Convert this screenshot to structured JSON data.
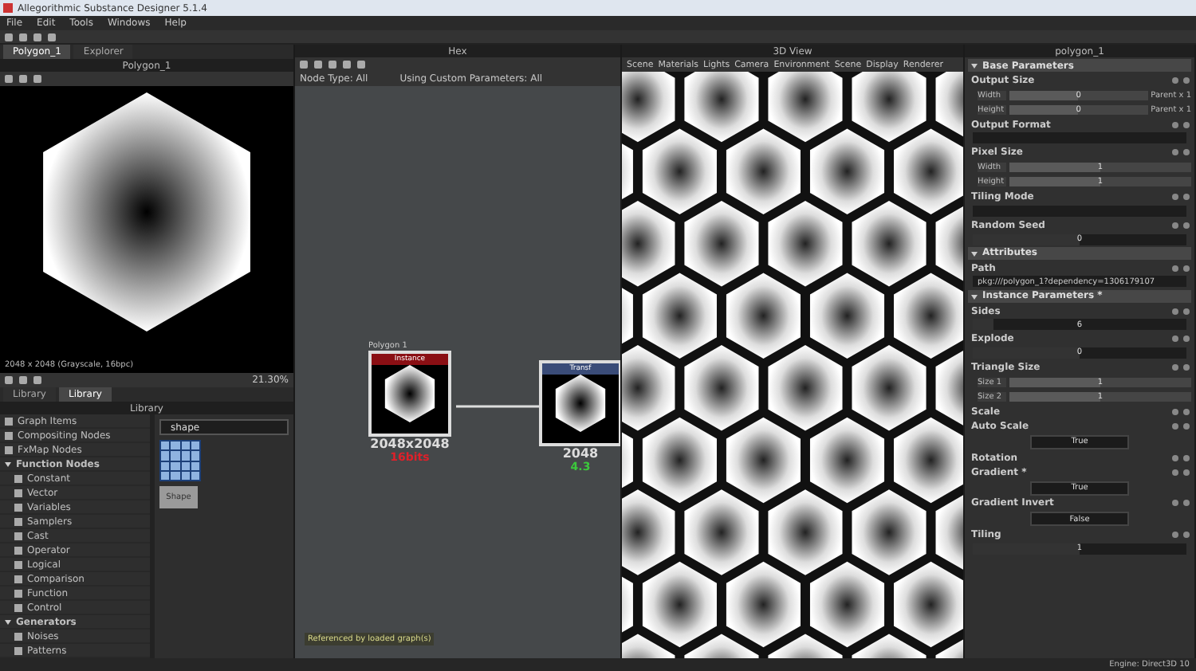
{
  "window": {
    "title": "Allegorithmic Substance Designer 5.1.4"
  },
  "menu": [
    "File",
    "Edit",
    "Tools",
    "Windows",
    "Help"
  ],
  "view_2d": {
    "tabs": [
      {
        "label": "Polygon_1",
        "selected": true
      },
      {
        "label": "Explorer",
        "selected": false
      }
    ],
    "title": "Polygon_1",
    "caption": "2048 x 2048 (Grayscale, 16bpc)",
    "zoom": "21.30%"
  },
  "library": {
    "tabs": [
      {
        "label": "Library",
        "selected": false
      },
      {
        "label": "Library",
        "selected": true
      }
    ],
    "title": "Library",
    "search": "shape",
    "result": "Shape",
    "tree": [
      {
        "label": "Graph Items"
      },
      {
        "label": "Compositing Nodes"
      },
      {
        "label": "FxMap Nodes"
      },
      {
        "label": "Function Nodes",
        "expanded": true,
        "children": [
          {
            "label": "Constant"
          },
          {
            "label": "Vector"
          },
          {
            "label": "Variables"
          },
          {
            "label": "Samplers"
          },
          {
            "label": "Cast"
          },
          {
            "label": "Operator"
          },
          {
            "label": "Logical"
          },
          {
            "label": "Comparison"
          },
          {
            "label": "Function"
          },
          {
            "label": "Control"
          }
        ]
      },
      {
        "label": "Generators",
        "expanded": true,
        "children": [
          {
            "label": "Noises"
          },
          {
            "label": "Patterns"
          }
        ]
      }
    ]
  },
  "graph": {
    "title": "Hex",
    "filters": [
      "Node Type: All",
      "Using Custom Parameters: All"
    ],
    "nodes": [
      {
        "frame_label": "Polygon 1",
        "header": {
          "label": "Instance",
          "color": "#8a0f14"
        },
        "size": "2048x2048",
        "format": {
          "label": "16bits",
          "color": "#e0202a"
        }
      },
      {
        "header": {
          "label": "Transf",
          "color": "#3a4c78"
        },
        "size": "2048",
        "format": {
          "label": "4.3",
          "color": "#3cc83c"
        }
      }
    ],
    "footer": "Referenced by loaded graph(s)"
  },
  "view_3d": {
    "title": "3D View",
    "menu": [
      "Scene",
      "Materials",
      "Lights",
      "Camera",
      "Environment",
      "Scene",
      "Display",
      "Renderer"
    ]
  },
  "parameters": {
    "title": "polygon_1",
    "rows": [
      {
        "kind": "section",
        "label": "Base Parameters"
      },
      {
        "kind": "param",
        "label": "Output Size"
      },
      {
        "kind": "sub",
        "label": "Width",
        "value": "0",
        "suffix": "Parent x 1",
        "level": 0.5
      },
      {
        "kind": "sub",
        "label": "Height",
        "value": "0",
        "suffix": "Parent x 1",
        "level": 0.5
      },
      {
        "kind": "param",
        "label": "Output Format"
      },
      {
        "kind": "field"
      },
      {
        "kind": "param",
        "label": "Pixel Size"
      },
      {
        "kind": "sub",
        "label": "Width",
        "value": "1",
        "level": 0.5
      },
      {
        "kind": "sub",
        "label": "Height",
        "value": "1",
        "level": 0.5
      },
      {
        "kind": "param",
        "label": "Tiling Mode"
      },
      {
        "kind": "field"
      },
      {
        "kind": "param",
        "label": "Random Seed"
      },
      {
        "kind": "slider",
        "value": "0",
        "level": 0.5
      },
      {
        "kind": "section",
        "label": "Attributes"
      },
      {
        "kind": "param",
        "label": "Path"
      },
      {
        "kind": "field",
        "value": "pkg:///polygon_1?dependency=1306179107"
      },
      {
        "kind": "section",
        "label": "Instance Parameters *"
      },
      {
        "kind": "param",
        "label": "Sides"
      },
      {
        "kind": "slider",
        "value": "6",
        "level": 0.1
      },
      {
        "kind": "param",
        "label": "Explode"
      },
      {
        "kind": "slider",
        "value": "0",
        "level": 0.5
      },
      {
        "kind": "param",
        "label": "Triangle Size"
      },
      {
        "kind": "sub",
        "label": "Size 1",
        "value": "1",
        "level": 0.5
      },
      {
        "kind": "sub",
        "label": "Size 2",
        "value": "1",
        "level": 0.5
      },
      {
        "kind": "param",
        "label": "Scale"
      },
      {
        "kind": "param",
        "label": "Auto Scale"
      },
      {
        "kind": "button",
        "value": "True"
      },
      {
        "kind": "param",
        "label": "Rotation"
      },
      {
        "kind": "param",
        "label": "Gradient *"
      },
      {
        "kind": "button",
        "value": "True"
      },
      {
        "kind": "param",
        "label": "Gradient Invert"
      },
      {
        "kind": "button",
        "value": "False"
      },
      {
        "kind": "param",
        "label": "Tiling"
      },
      {
        "kind": "slider",
        "value": "1",
        "level": 0.5
      }
    ]
  },
  "status_bar": "Engine: Direct3D 10"
}
